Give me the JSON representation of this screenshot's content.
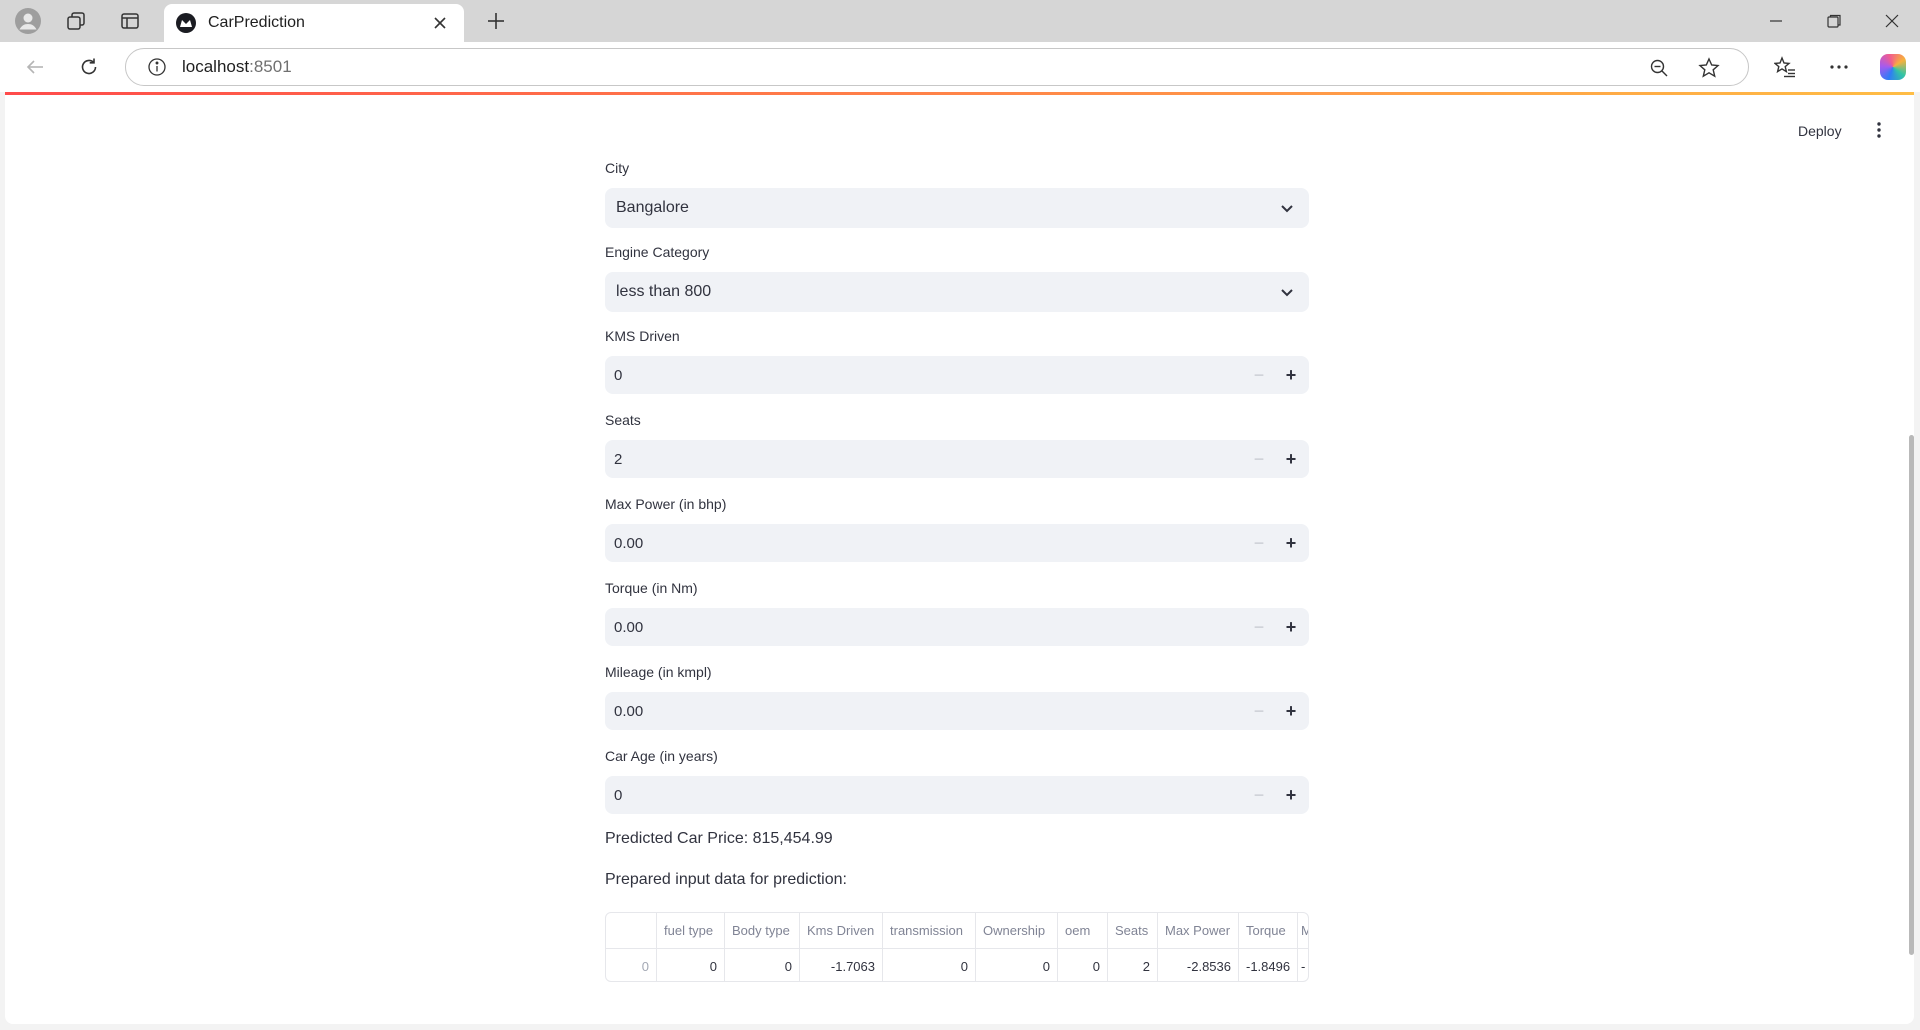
{
  "browser": {
    "tab_title": "CarPrediction",
    "url_host": "localhost",
    "url_port": ":8501"
  },
  "header": {
    "deploy_label": "Deploy"
  },
  "form": {
    "city": {
      "label": "City",
      "value": "Bangalore"
    },
    "engine_category": {
      "label": "Engine Category",
      "value": "less than 800"
    },
    "kms_driven": {
      "label": "KMS Driven",
      "value": "0"
    },
    "seats": {
      "label": "Seats",
      "value": "2"
    },
    "max_power": {
      "label": "Max Power (in bhp)",
      "value": "0.00"
    },
    "torque": {
      "label": "Torque (in Nm)",
      "value": "0.00"
    },
    "mileage": {
      "label": "Mileage (in kmpl)",
      "value": "0.00"
    },
    "car_age": {
      "label": "Car Age (in years)",
      "value": "0"
    }
  },
  "result": {
    "predicted_text": "Predicted Car Price: 815,454.99",
    "prepared_text": "Prepared input data for prediction:"
  },
  "table": {
    "columns": [
      "",
      "fuel type",
      "Body type",
      "Kms Driven",
      "transmission",
      "Ownership",
      "oem",
      "Seats",
      "Max Power",
      "Torque",
      "M"
    ],
    "rows": [
      [
        "0",
        "0",
        "0",
        "-1.7063",
        "0",
        "0",
        "0",
        "2",
        "-2.8536",
        "-1.8496",
        "-"
      ]
    ]
  },
  "colors": {
    "input_bg": "#f0f2f6",
    "text": "#31333f",
    "decoration_start": "#ff4b4b",
    "decoration_end": "#ffbd45"
  }
}
